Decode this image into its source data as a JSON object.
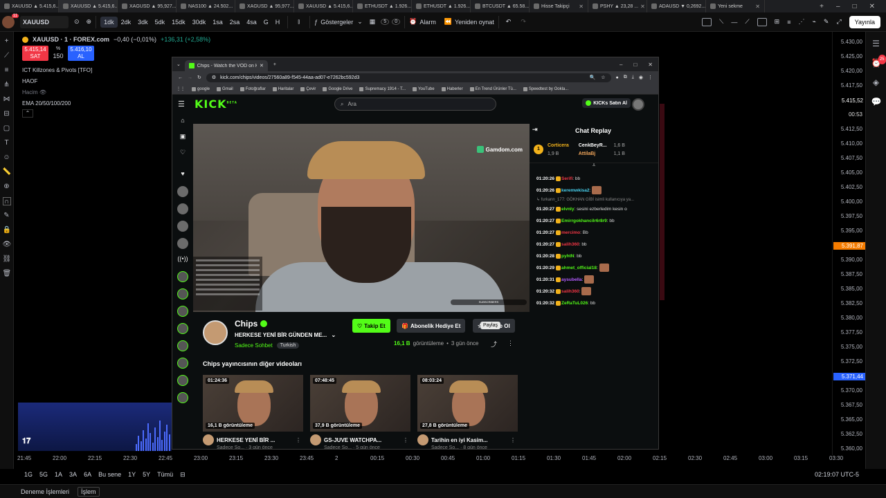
{
  "outer_tabs": [
    {
      "label": "XAUUSD ▲ 5.415,6...",
      "active": false
    },
    {
      "label": "XAUUSD ▲ 5.415,6...",
      "active": true
    },
    {
      "label": "XAGUSD ▲ 95,927...",
      "active": false
    },
    {
      "label": "NAS100 ▲ 24.502...",
      "active": false
    },
    {
      "label": "XAGUSD ▲ 95,977...",
      "active": false
    },
    {
      "label": "XAUUSD ▲ 5.415,6...",
      "active": false
    },
    {
      "label": "ETHUSDT ▲ 1.926...",
      "active": false
    },
    {
      "label": "ETHUSDT ▲ 1.926...",
      "active": false
    },
    {
      "label": "BTCUSDT ▲ 65.58...",
      "active": false
    },
    {
      "label": "Hisse Takipçi",
      "active": false
    },
    {
      "label": "PSHY ▲ 23,28 ...",
      "active": false
    },
    {
      "label": "ADAUSD ▼ 0,2692...",
      "active": false
    },
    {
      "label": "Yeni sekme",
      "active": false
    }
  ],
  "tv_toolbar": {
    "notif_count": "11",
    "symbol": "XAUUSD",
    "intervals": [
      "1dk",
      "2dk",
      "3dk",
      "5dk",
      "15dk",
      "30dk",
      "1sa",
      "2sa",
      "4sa",
      "G",
      "H"
    ],
    "active_interval": "1dk",
    "indicators_label": "Göstergeler",
    "layout_count": "5",
    "layout_zero": "0",
    "alarm_label": "Alarm",
    "replay_label": "Yeniden oynat",
    "publish_label": "Yayınla"
  },
  "legend": {
    "symbol_line": "XAUUSD · 1 · FOREX.com",
    "change": "−0,40 (−0,01%)",
    "change2": "+136,31 (+2,58%)",
    "sell_price": "5.415,14",
    "sell_label": "SAT",
    "spread_label": "%",
    "spread": "150",
    "buy_price": "5.416,10",
    "buy_label": "AL",
    "indicators": [
      "ICT Killzones & Pivots [TFO]",
      "HAOF"
    ],
    "volume_label": "Hacim",
    "ema_label": "EMA 20/50/100/200"
  },
  "price_ticks": [
    "5.430,00",
    "5.425,00",
    "5.420,00",
    "5.417,50",
    "5.415,52",
    "00:53",
    "5.412,50",
    "5.410,00",
    "5.407,50",
    "5.405,00",
    "5.402,50",
    "5.400,00",
    "5.397,50",
    "5.395,00",
    "5.391,87",
    "5.390,00",
    "5.387,50",
    "5.385,00",
    "5.382,50",
    "5.380,00",
    "5.377,50",
    "5.375,00",
    "5.372,50",
    "5.371,44",
    "5.370,00",
    "5.367,50",
    "5.365,00",
    "5.362,50",
    "5.360,00"
  ],
  "time_ticks": [
    "21:45",
    "22:00",
    "22:15",
    "22:30",
    "22:45",
    "23:00",
    "23:15",
    "23:30",
    "23:45",
    "2",
    "00:15",
    "00:30",
    "00:45",
    "01:00",
    "01:15",
    "01:30",
    "01:45",
    "02:00",
    "02:15",
    "02:30",
    "02:45",
    "03:00",
    "03:15",
    "03:30"
  ],
  "bottom_bar": {
    "ranges": [
      "1G",
      "5G",
      "1A",
      "3A",
      "6A",
      "Bu sene",
      "1Y",
      "5Y",
      "Tümü"
    ],
    "clock": "02:19:07 UTC-5"
  },
  "footer": {
    "demo_label": "Deneme İşlemleri",
    "trade_label": "İşlem"
  },
  "kick_window": {
    "tab_title": "Chips - Watch the VOD on K...",
    "url": "kick.com/chips/videos/27560a89-f545-44aa-ad07-e7262bc592d3",
    "bookmarks": [
      "google",
      "Gmail",
      "Fotoğraflar",
      "Haritalar",
      "Çevir",
      "Google Drive",
      "Supremacy 1914 - T...",
      "YouTube",
      "Haberler",
      "En Trend Ürünler Tü...",
      "Speedtest by Ookla..."
    ],
    "logo": "KICK",
    "logo_sup": "BETA",
    "search_placeholder": "Ara",
    "buy_kicks": "KICKs Satın Al",
    "gamdom": "Gamdom.com",
    "subs_bar": "SUBSCRIBERS",
    "chat": {
      "title": "Chat Replay",
      "gifters": [
        {
          "rank": "1",
          "name": "Corticera",
          "amount": "1,9 B"
        },
        {
          "rank": "",
          "name": "CenkBeyR...",
          "amount": "1,6 B"
        },
        {
          "rank": "",
          "name": "AttilaBj",
          "amount": "1,1 B"
        }
      ],
      "messages": [
        {
          "time": "01:20:26",
          "user": "Serifi",
          "text": ": bb",
          "color": "#f23645",
          "sticker": false,
          "system": false
        },
        {
          "time": "01:20:26",
          "user": "keremwkisa2",
          "text": ":",
          "color": "#4ad3f0",
          "sticker": true,
          "system": false
        },
        {
          "time": "",
          "user": "",
          "text": "↳ furkann_177: GÖKHAN GİBİ isimli kullanıcıya ya...",
          "color": "#888",
          "sticker": false,
          "system": true
        },
        {
          "time": "01:20:27",
          "user": "elvnly",
          "text": ": sesini ezberledim kesin o",
          "color": "#53fc18",
          "sticker": false,
          "system": false
        },
        {
          "time": "01:20:27",
          "user": "Emirrgokhancilr6r8r9",
          "text": ": bb",
          "color": "#53fc18",
          "sticker": false,
          "system": false
        },
        {
          "time": "01:20:27",
          "user": "mercimo",
          "text": ": Bb",
          "color": "#f23645",
          "sticker": false,
          "system": false
        },
        {
          "time": "01:20:27",
          "user": "salih360",
          "text": ": bb",
          "color": "#f23645",
          "sticker": false,
          "system": false
        },
        {
          "time": "01:20:28",
          "user": "pyhtN",
          "text": ": bb",
          "color": "#53fc18",
          "sticker": false,
          "system": false
        },
        {
          "time": "01:20:29",
          "user": "ahmet_official18",
          "text": ":",
          "color": "#53fc18",
          "sticker": true,
          "system": false
        },
        {
          "time": "01:20:31",
          "user": "aysubella",
          "text": ":",
          "color": "#b45cff",
          "sticker": true,
          "system": false
        },
        {
          "time": "01:20:32",
          "user": "salih360",
          "text": ":",
          "color": "#f23645",
          "sticker": true,
          "system": false
        },
        {
          "time": "01:20:32",
          "user": "ZeRaTuL026",
          "text": ": bb",
          "color": "#53fc18",
          "sticker": false,
          "system": false
        }
      ]
    },
    "channel": {
      "name": "Chips",
      "title": "HERKESE YENİ BİR GÜNDEN ME...",
      "category": "Sadece Sohbet",
      "tag": "Turkish",
      "follow_label": "Takip Et",
      "gift_label": "Abonelik Hediye Et",
      "sub_label": "Abone Ol",
      "tooltip": "Paylaş",
      "views": "16,1 B",
      "views_label": "görüntüleme",
      "time_ago": "3 gün önce"
    },
    "other_videos_title": "Chips yayıncısının diğer videoları",
    "other_videos": [
      {
        "duration": "01:24:36",
        "views": "16,1 B görüntüleme",
        "title": "HERKESE YENİ BİR ...",
        "sub": "Sadece So...  · 3 gün önce"
      },
      {
        "duration": "07:48:45",
        "views": "37,9 B görüntüleme",
        "title": "GS-JUVE WATCHPA...",
        "sub": "Sadece So...  · 5 gün önce"
      },
      {
        "duration": "08:03:24",
        "views": "27,8 B görüntüleme",
        "title": "Tarihin en iyi Kasim...",
        "sub": "Sadece So...  · 8 gün önce"
      }
    ]
  }
}
